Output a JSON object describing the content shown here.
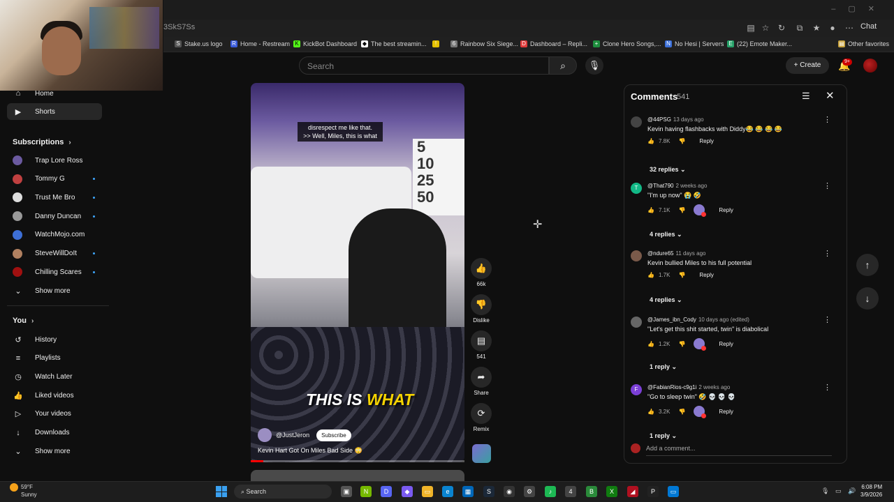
{
  "browser": {
    "url": "3SkS7Ss",
    "chat_label": "Chat",
    "bookmarks": [
      {
        "label": "Stake.us logo",
        "color": "#555555",
        "icon": "S"
      },
      {
        "label": "Home - Restream",
        "color": "#3a5bd9",
        "icon": "R"
      },
      {
        "label": "KickBot Dashboard",
        "color": "#53fc18",
        "icon": "K"
      },
      {
        "label": "The best streamin...",
        "color": "#ffffff",
        "icon": "◆"
      },
      {
        "label": "",
        "color": "#e5c100",
        "icon": "!"
      },
      {
        "label": "Rainbow Six Siege...",
        "color": "#777777",
        "icon": "6"
      },
      {
        "label": "Dashboard – Repli...",
        "color": "#e03b3b",
        "icon": "D"
      },
      {
        "label": "Clone Hero Songs,...",
        "color": "#1e8e3e",
        "icon": "+"
      },
      {
        "label": "No Hesi | Servers",
        "color": "#3a6fd9",
        "icon": "N"
      },
      {
        "label": "(22) Emote Maker...",
        "color": "#26a269",
        "icon": "E"
      },
      {
        "label": "Other favorites",
        "color": "#c8a23c",
        "icon": "▤"
      }
    ]
  },
  "header": {
    "search_placeholder": "Search",
    "create_label": "Create",
    "notif_badge": "9+"
  },
  "sidebar": {
    "main": [
      {
        "label": "Home",
        "icon": "home-icon",
        "glyph": "⌂"
      },
      {
        "label": "Shorts",
        "icon": "shorts-icon",
        "glyph": "▶"
      }
    ],
    "subscriptions_title": "Subscriptions",
    "subscriptions": [
      {
        "label": "Trap Lore Ross",
        "color": "#6b5aa0",
        "dot": false
      },
      {
        "label": "Tommy G",
        "color": "#c04040",
        "dot": true
      },
      {
        "label": "Trust Me Bro",
        "color": "#dddddd",
        "dot": true
      },
      {
        "label": "Danny Duncan",
        "color": "#999999",
        "dot": true
      },
      {
        "label": "WatchMojo.com",
        "color": "#3d6fd6",
        "dot": false
      },
      {
        "label": "SteveWillDoIt",
        "color": "#b08060",
        "dot": true
      },
      {
        "label": "Chilling Scares",
        "color": "#a01010",
        "dot": true
      }
    ],
    "show_more": "Show more",
    "you_title": "You",
    "you_items": [
      {
        "label": "History",
        "icon": "history-icon",
        "glyph": "↺"
      },
      {
        "label": "Playlists",
        "icon": "playlists-icon",
        "glyph": "≡"
      },
      {
        "label": "Watch Later",
        "icon": "watch-later-icon",
        "glyph": "◷"
      },
      {
        "label": "Liked videos",
        "icon": "like-icon",
        "glyph": "👍"
      },
      {
        "label": "Your videos",
        "icon": "your-videos-icon",
        "glyph": "▷"
      },
      {
        "label": "Downloads",
        "icon": "download-icon",
        "glyph": "↓"
      }
    ],
    "show_more_2": "Show more"
  },
  "video": {
    "caption_top_1": "disrespect me like that.",
    "caption_top_2": ">> Well, Miles, this is what",
    "caption_big_1": "THIS IS",
    "caption_big_2": "WHAT",
    "channel": "@JustJeron",
    "subscribe": "Subscribe",
    "title": "Kevin Hart Got On Miles Bad Side 😳",
    "progress": 0.06,
    "poster_lines": [
      "5",
      "10",
      "25",
      "50"
    ]
  },
  "actions": {
    "likes": "66k",
    "dislike": "Dislike",
    "comments": "541",
    "share": "Share",
    "remix": "Remix"
  },
  "comments": {
    "title": "Comments",
    "count": "541",
    "items": [
      {
        "user": "@44PSG",
        "ago": "13 days ago",
        "text": "Kevin having flashbacks with Diddy😂 😂 😂 😂",
        "likes": "7.8K",
        "hearted": false,
        "replies": "32 replies",
        "avatar_color": "#444444",
        "initial": ""
      },
      {
        "user": "@That790",
        "ago": "2 weeks ago",
        "text": "\"I'm up now\" 😭 🤣",
        "likes": "7.1K",
        "hearted": true,
        "replies": "4 replies",
        "avatar_color": "#12b886",
        "initial": "T"
      },
      {
        "user": "@ndure65",
        "ago": "11 days ago",
        "text": "Kevin bullied Miles to his full potential",
        "likes": "1.7K",
        "hearted": false,
        "replies": "4 replies",
        "avatar_color": "#7a5a4a",
        "initial": ""
      },
      {
        "user": "@James_ibn_Cody",
        "ago": "10 days ago (edited)",
        "text": "\"Let's get this shit started, twin\" is diabolical",
        "likes": "1.2K",
        "hearted": true,
        "replies": "1 reply",
        "avatar_color": "#666666",
        "initial": ""
      },
      {
        "user": "@FabianRios-c9g1i",
        "ago": "2 weeks ago",
        "text": "\"Go to sleep twin\" 🤣 💀 💀 💀",
        "likes": "3.2K",
        "hearted": true,
        "replies": "1 reply",
        "avatar_color": "#7b3fd6",
        "initial": "F"
      }
    ],
    "reply_label": "Reply",
    "add_placeholder": "Add a comment..."
  },
  "taskbar": {
    "temp": "59°F",
    "weather": "Sunny",
    "search": "Search",
    "time": "6:08 PM",
    "date": "3/9/2026"
  }
}
